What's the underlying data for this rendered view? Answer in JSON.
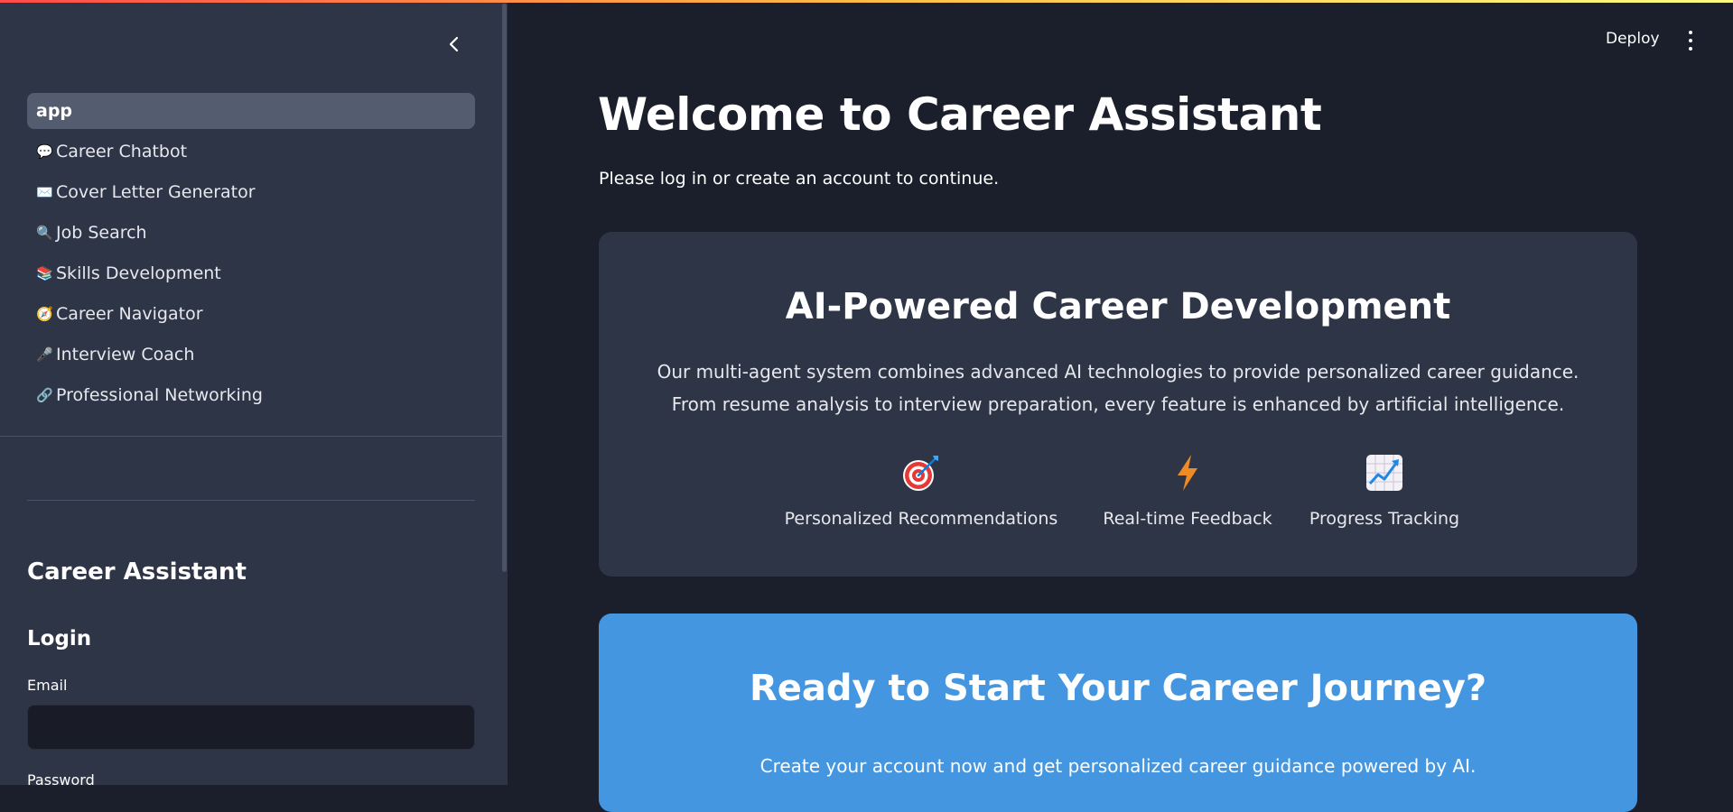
{
  "header": {
    "deploy_label": "Deploy"
  },
  "sidebar": {
    "items": [
      {
        "label": "app",
        "icon": "",
        "active": true
      },
      {
        "label": "Career Chatbot",
        "icon": "💬"
      },
      {
        "label": "Cover Letter Generator",
        "icon": "✉️"
      },
      {
        "label": "Job Search",
        "icon": "🔍"
      },
      {
        "label": "Skills Development",
        "icon": "📚"
      },
      {
        "label": "Career Navigator",
        "icon": "🧭"
      },
      {
        "label": "Interview Coach",
        "icon": "🎤"
      },
      {
        "label": "Professional Networking",
        "icon": "🔗"
      }
    ],
    "app_title": "Career Assistant",
    "login_heading": "Login",
    "email_label": "Email",
    "email_value": "",
    "password_label": "Password"
  },
  "main": {
    "title": "Welcome to Career Assistant",
    "subtitle": "Please log in or create an account to continue.",
    "card": {
      "title": "AI-Powered Career Development",
      "desc_line1": "Our multi-agent system combines advanced AI technologies to provide personalized career guidance.",
      "desc_line2": "From resume analysis to interview preparation, every feature is enhanced by artificial intelligence.",
      "features": [
        {
          "label": "Personalized Recommendations",
          "icon": "target-icon"
        },
        {
          "label": "Real-time Feedback",
          "icon": "lightning-icon"
        },
        {
          "label": "Progress Tracking",
          "icon": "chart-increasing-icon"
        }
      ]
    },
    "cta": {
      "title": "Ready to Start Your Career Journey?",
      "desc": "Create your account now and get personalized career guidance powered by AI."
    }
  },
  "colors": {
    "sidebar_bg": "#2e3546",
    "main_bg": "#1b1f2b",
    "card_bg": "#2e3546",
    "cta_bg": "#4496e0",
    "active_item_bg": "#545c6f"
  }
}
